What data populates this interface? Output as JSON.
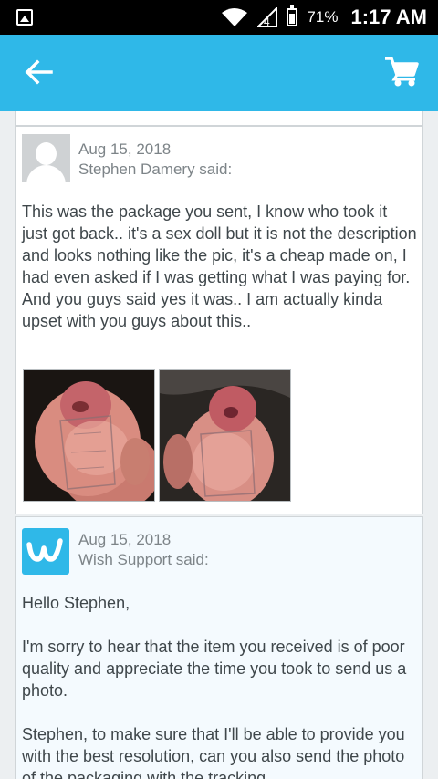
{
  "status_bar": {
    "battery_percent": "71%",
    "time": "1:17 AM",
    "icons": [
      "gallery-icon",
      "wifi-icon",
      "signal-icon",
      "battery-icon"
    ]
  },
  "app_bar": {
    "icons": [
      "back-arrow-icon",
      "shopping-cart-icon"
    ],
    "color": "#2fb8e8"
  },
  "messages": [
    {
      "date": "Aug 15, 2018",
      "author": "Stephen Damery said:",
      "avatar_icon": "default-avatar-icon",
      "paragraphs": [
        "This was the package you sent, I know who took it just got back.. it's a sex doll but it is not the description and looks nothing like the pic, it's a cheap made on, I had even asked if I was getting what I was paying for. And you guys said yes it was.. I am actually kinda upset with you guys about this.."
      ],
      "attachments": [
        "attachment-photo-1",
        "attachment-photo-2"
      ]
    },
    {
      "date": "Aug 15, 2018",
      "author": "Wish Support said:",
      "avatar_icon": "wish-logo-icon",
      "paragraphs": [
        "Hello Stephen,",
        "I'm sorry to hear that the item you received is of poor quality and appreciate the time you took to send us a photo.",
        "Stephen, to make sure that I'll be able to provide you with the best resolution, can you also send the photo of the packaging with the tracking"
      ]
    }
  ]
}
